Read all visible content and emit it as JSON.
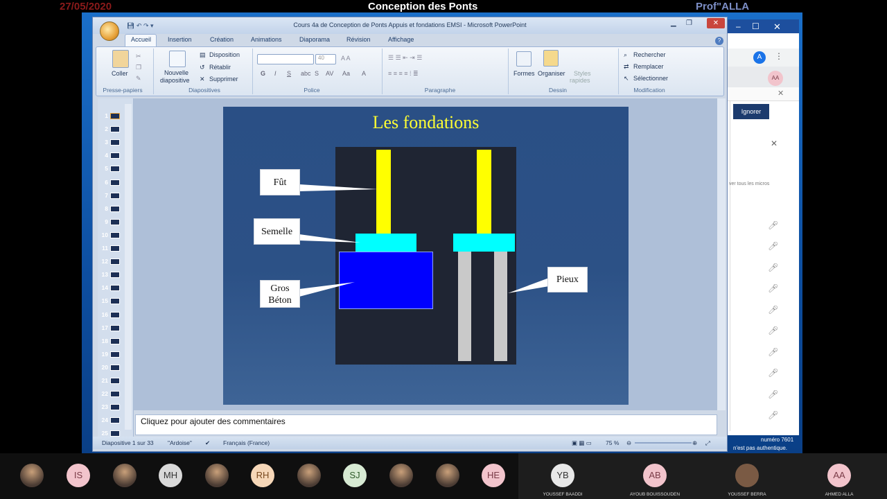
{
  "header": {
    "date": "27/05/2020",
    "course": "Conception des Ponts",
    "prof": "Prof\"ALLA"
  },
  "ppt": {
    "title": "Cours 4a de Conception de Ponts Appuis et fondations EMSI - Microsoft PowerPoint",
    "tabs": [
      "Accueil",
      "Insertion",
      "Création",
      "Animations",
      "Diaporama",
      "Révision",
      "Affichage"
    ],
    "ribbon": {
      "coller": "Coller",
      "presse_papiers": "Presse-papiers",
      "nouvelle_diapositive_1": "Nouvelle",
      "nouvelle_diapositive_2": "diapositive",
      "disposition": "Disposition",
      "retablir": "Rétablir",
      "supprimer": "Supprimer",
      "diapositives": "Diapositives",
      "font_size": "40",
      "police": "Police",
      "paragraphe": "Paragraphe",
      "formes": "Formes",
      "organiser": "Organiser",
      "styles_rapides_1": "Styles",
      "styles_rapides_2": "rapides",
      "dessin": "Dessin",
      "rechercher": "Rechercher",
      "remplacer": "Remplacer",
      "selectionner": "Sélectionner",
      "modification": "Modification"
    },
    "slide_numbers": [
      "1",
      "2",
      "3",
      "4",
      "5",
      "6",
      "7",
      "8",
      "9",
      "10",
      "11",
      "12",
      "13",
      "14",
      "15",
      "16",
      "17",
      "18",
      "19",
      "20",
      "21",
      "22",
      "23",
      "24",
      "25"
    ],
    "slide": {
      "title": "Les fondations",
      "label_fut": "Fût",
      "label_semelle": "Semelle",
      "label_gros_1": "Gros",
      "label_gros_2": "Béton",
      "label_pieux": "Pieux"
    },
    "notes_placeholder": "Cliquez pour ajouter des commentaires",
    "status": {
      "slide_counter": "Diapositive 1 sur 33",
      "theme": "\"Ardoise\"",
      "language": "Français (France)",
      "zoom": "75 %"
    }
  },
  "browser": {
    "avatar_a": "A",
    "avatar_aa": "AA",
    "ignore_button": "Ignorer",
    "mute_all": "ver tous les micros",
    "win_status_1": "numéro 7601",
    "win_status_2": "n'est pas authentique."
  },
  "participants": [
    {
      "initials": "IS",
      "bg": "#f2c4cc",
      "fg": "#7a3b47"
    },
    {
      "initials": "MH",
      "bg": "#d9d9d9",
      "fg": "#333333"
    },
    {
      "initials": "RH",
      "bg": "#f6d7b8",
      "fg": "#7a4a1f"
    },
    {
      "initials": "SJ",
      "bg": "#d7ead3",
      "fg": "#2f5a2a"
    },
    {
      "initials": "HE",
      "bg": "#f2c4cc",
      "fg": "#7a3b47"
    },
    {
      "initials": "YB",
      "bg": "#e8e8e8",
      "fg": "#333333",
      "name": "YOUSSEF BAADDI"
    },
    {
      "initials": "AB",
      "bg": "#f2c4cc",
      "fg": "#7a3b47",
      "name": "AYOUB BOUISSOUDEN"
    },
    {
      "initials": "",
      "name": "YOUSSEF BERRA"
    },
    {
      "initials": "AA",
      "bg": "#f2c4cc",
      "fg": "#7a3b47",
      "name": "AHMED ALLA"
    }
  ]
}
